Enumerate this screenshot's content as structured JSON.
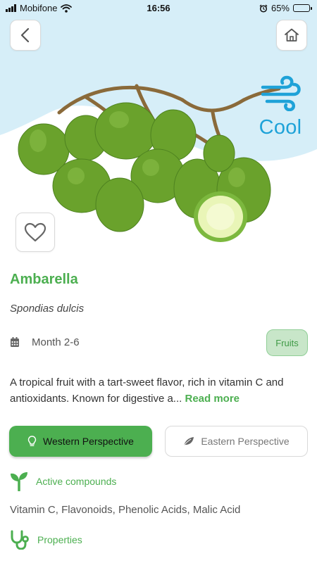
{
  "status_bar": {
    "carrier": "Mobifone",
    "time": "16:56",
    "battery": "65%",
    "battery_level": 0.65
  },
  "nav": {
    "back_icon": "chevron-left-icon",
    "home_icon": "home-icon"
  },
  "hero": {
    "temperature_label": "Cool",
    "temperature_icon": "wind-icon",
    "colors": {
      "sky": "#d6eef8",
      "cool": "#1ea2d8"
    }
  },
  "fruit": {
    "name": "Ambarella",
    "scientific_name": "Spondias dulcis",
    "season": "Month 2-6",
    "category": "Fruits",
    "description": "A tropical fruit with a tart-sweet flavor, rich in vitamin C and antioxidants. Known for digestive a...",
    "read_more": "Read more"
  },
  "tabs": [
    {
      "label": "Western Perspective",
      "icon": "lightbulb-icon",
      "active": true
    },
    {
      "label": "Eastern Perspective",
      "icon": "leaf-icon",
      "active": false
    }
  ],
  "sections": {
    "compounds_title": "Active compounds",
    "compounds_text": "Vitamin C, Flavonoids, Phenolic Acids, Malic Acid",
    "properties_title": "Properties"
  },
  "colors": {
    "accent": "#4caf50",
    "accent_light": "#c8e6c9"
  }
}
